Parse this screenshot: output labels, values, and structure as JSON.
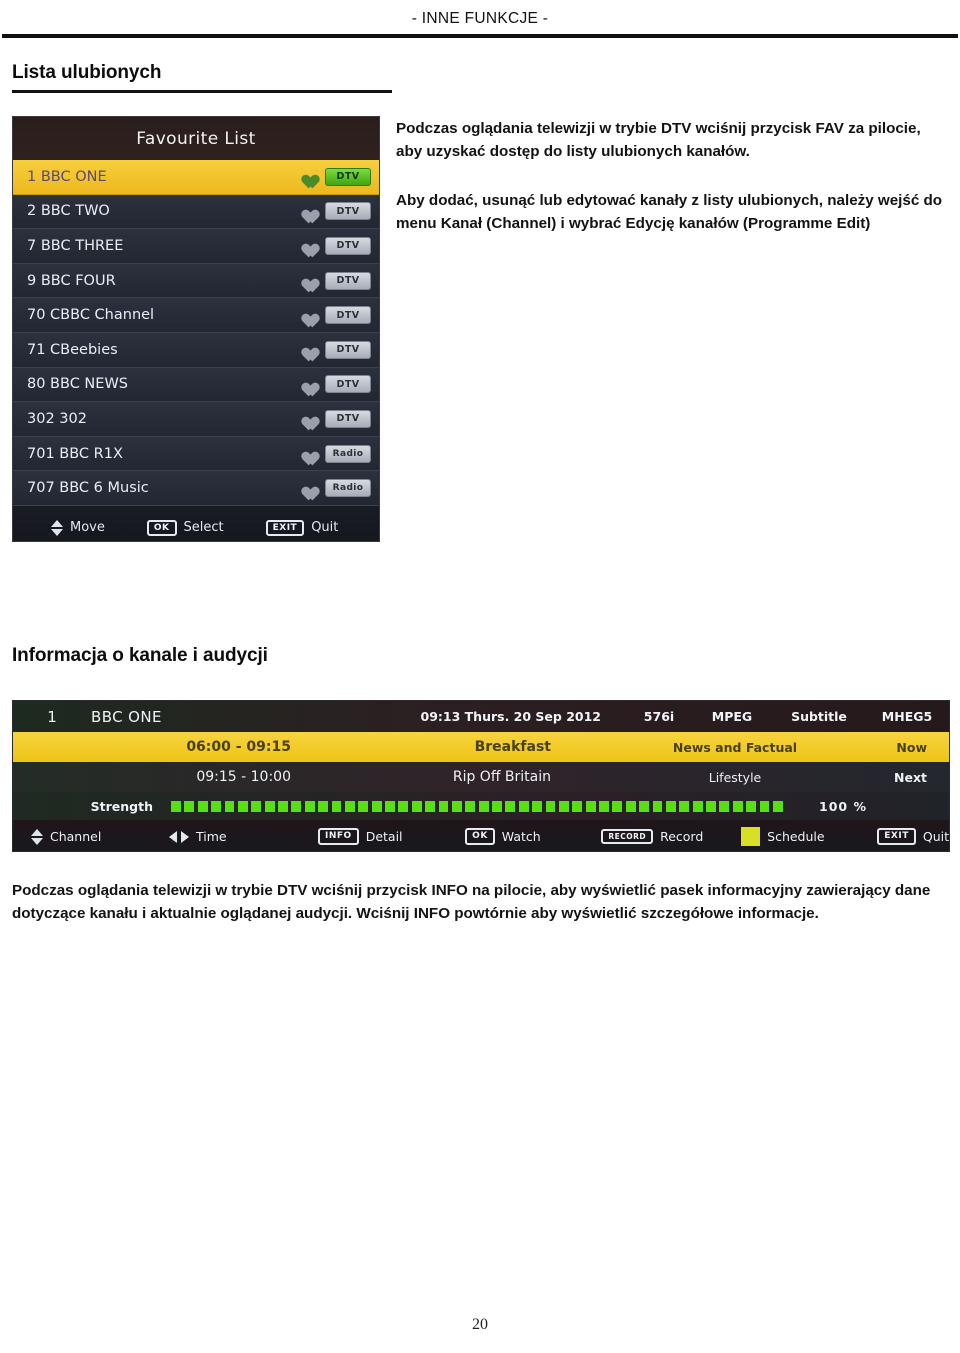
{
  "header": {
    "running_title": "- INNE FUNKCJE -"
  },
  "sections": [
    {
      "title": "Lista ulubionych"
    },
    {
      "title": "Informacja o kanale i audycji"
    }
  ],
  "favourite_list": {
    "title": "Favourite List",
    "columns": [
      "channel",
      "favourite",
      "type"
    ],
    "rows": [
      {
        "label": "1 BBC ONE",
        "badge": "DTV",
        "selected": true
      },
      {
        "label": "2 BBC TWO",
        "badge": "DTV",
        "selected": false
      },
      {
        "label": "7 BBC THREE",
        "badge": "DTV",
        "selected": false
      },
      {
        "label": "9 BBC FOUR",
        "badge": "DTV",
        "selected": false
      },
      {
        "label": "70 CBBC Channel",
        "badge": "DTV",
        "selected": false
      },
      {
        "label": "71 CBeebies",
        "badge": "DTV",
        "selected": false
      },
      {
        "label": "80 BBC NEWS",
        "badge": "DTV",
        "selected": false
      },
      {
        "label": "302 302",
        "badge": "DTV",
        "selected": false
      },
      {
        "label": "701 BBC R1X",
        "badge": "Radio",
        "selected": false
      },
      {
        "label": "707 BBC 6 Music",
        "badge": "Radio",
        "selected": false
      }
    ],
    "footer": {
      "move_label": "Move",
      "ok_key": "OK",
      "select_label": "Select",
      "exit_key": "EXIT",
      "quit_label": "Quit"
    },
    "colors": {
      "selected_row": "#f1c322",
      "header_bar": "#2c1f1d",
      "row": "#272d38",
      "badge_dtv_selected": "#5ec41f",
      "heart_selected": "#4a8b2c"
    }
  },
  "info_banner": {
    "channel_number": "1",
    "channel_name": "BBC ONE",
    "clock": "09:13 Thurs. 20 Sep 2012",
    "resolution": "576i",
    "codec": "MPEG",
    "subtitle": "Subtitle",
    "mheg": "MHEG5",
    "now": {
      "time": "06:00 - 09:15",
      "programme": "Breakfast",
      "genre": "News and Factual",
      "when": "Now"
    },
    "next": {
      "time": "09:15 - 10:00",
      "programme": "Rip Off Britain",
      "genre": "Lifestyle",
      "when": "Next"
    },
    "strength": {
      "label": "Strength",
      "percent": "100 %",
      "segments": 46,
      "filled": 46,
      "color": "#56e015"
    },
    "footer": {
      "channel_label": "Channel",
      "time_label": "Time",
      "info_key": "INFO",
      "detail_label": "Detail",
      "ok_key": "OK",
      "watch_label": "Watch",
      "record_key": "RECORD",
      "record_label": "Record",
      "schedule_label": "Schedule",
      "schedule_color": "#d9e024",
      "exit_key": "EXIT",
      "quit_label": "Quit"
    }
  },
  "body_text": {
    "fav_paragraph_1": "Podczas oglądania telewizji w trybie DTV wciśnij przycisk FAV za pilocie, aby uzyskać dostęp do listy ulubionych kanałów.",
    "fav_paragraph_2": "Aby dodać, usunąć lub edytować kanały z listy ulubionych, należy wejść do menu Kanał (Channel) i wybrać Edycję kanałów (Programme Edit)",
    "info_paragraph": "Podczas oglądania telewizji w trybie DTV wciśnij przycisk INFO na pilocie, aby wyświetlić pasek informacyjny zawierający dane dotyczące kanału i aktualnie oglądanej audycji. Wciśnij INFO powtórnie aby wyświetlić szczegółowe informacje."
  },
  "page_number": "20"
}
